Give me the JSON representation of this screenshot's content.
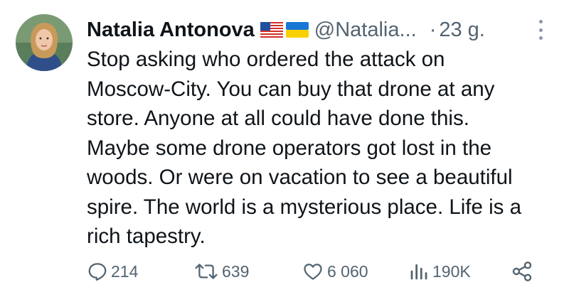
{
  "tweet": {
    "author_name": "Natalia Antonova",
    "handle": "@Natalia...",
    "separator": "·",
    "time": "23 g.",
    "flags": [
      "us-flag-icon",
      "ukraine-flag-icon"
    ],
    "text_lines": [
      "Stop asking who ordered the attack on",
      "Moscow-City. You can buy that drone at any",
      "store. Anyone at all could have done this.",
      "Maybe some drone operators got lost in the",
      "woods. Or were on vacation to see a beautiful",
      "spire. The world is a mysterious place. Life is a",
      "rich tapestry."
    ]
  },
  "actions": {
    "replies": "214",
    "reposts": "639",
    "likes": "6 060",
    "views": "190K"
  },
  "icons": {
    "reply": "reply-icon",
    "repost": "repost-icon",
    "like": "heart-icon",
    "views": "views-icon",
    "share": "share-icon",
    "more": "more-icon"
  },
  "colors": {
    "text": "#0f1419",
    "secondary": "#536471"
  }
}
